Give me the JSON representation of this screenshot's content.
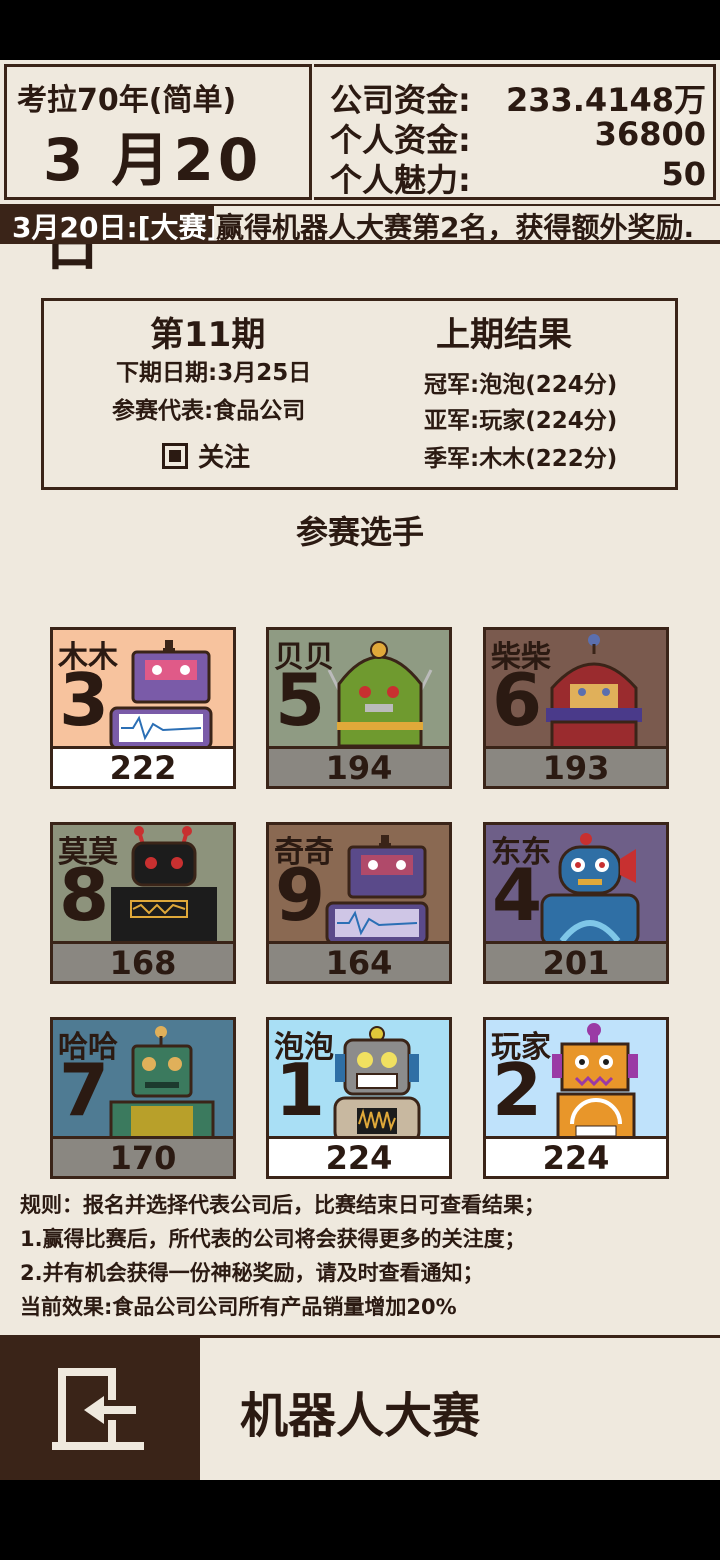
{
  "header": {
    "game_mode": "考拉70年(简单)",
    "date": "3 月20日",
    "company_funds_label": "公司资金:",
    "company_funds_value": "233.4148万",
    "personal_funds_label": "个人资金:",
    "personal_funds_value": "36800",
    "charm_label": "个人魅力:",
    "charm_value": "50"
  },
  "news": {
    "tag": "3月20日:[大赛]",
    "message": "赢得机器人大赛第2名，获得额外奖励."
  },
  "info": {
    "period": "第11期",
    "next_date": "下期日期:3月25日",
    "representative": "参赛代表:食品公司",
    "follow_label": "关注",
    "follow_checked": true,
    "last_results_title": "上期结果",
    "champion": "冠军:泡泡(224分)",
    "runner_up": "亚军:玩家(224分)",
    "third": "季军:木木(222分)"
  },
  "contestants_title": "参赛选手",
  "contestants": [
    {
      "name": "木木",
      "number": "3",
      "score": "222",
      "bg": "#f7c39e",
      "score_bg": "#ffffff"
    },
    {
      "name": "贝贝",
      "number": "5",
      "score": "194",
      "bg": "#8f9b83",
      "score_bg": "#8a8781"
    },
    {
      "name": "柴柴",
      "number": "6",
      "score": "193",
      "bg": "#7a5a4e",
      "score_bg": "#8a8781"
    },
    {
      "name": "莫莫",
      "number": "8",
      "score": "168",
      "bg": "#8d937c",
      "score_bg": "#8a8781"
    },
    {
      "name": "奇奇",
      "number": "9",
      "score": "164",
      "bg": "#8a6952",
      "score_bg": "#8a8781"
    },
    {
      "name": "东东",
      "number": "4",
      "score": "201",
      "bg": "#6e5f88",
      "score_bg": "#8a8781"
    },
    {
      "name": "哈哈",
      "number": "7",
      "score": "170",
      "bg": "#4f7b93",
      "score_bg": "#8a8781"
    },
    {
      "name": "泡泡",
      "number": "1",
      "score": "224",
      "bg": "#a9dff5",
      "score_bg": "#ffffff"
    },
    {
      "name": "玩家",
      "number": "2",
      "score": "224",
      "bg": "#bfe2fb",
      "score_bg": "#ffffff"
    }
  ],
  "rules": [
    "规则：报名并选择代表公司后，比赛结束日可查看结果；",
    "1.赢得比赛后，所代表的公司将会获得更多的关注度；",
    "2.并有机会获得一份神秘奖励，请及时查看通知；",
    "当前效果:食品公司公司所有产品销量增加20%"
  ],
  "footer": {
    "exit_icon": "exit-door-icon",
    "title": "机器人大赛"
  },
  "robot_art": [
    "robot-tv-purple",
    "robot-green-dome",
    "robot-red-dome",
    "robot-black-antenna",
    "robot-tv-purple",
    "robot-blue-round",
    "robot-green-square",
    "robot-silver-grin",
    "robot-orange-gauge"
  ],
  "colors": {
    "panel": "#efe9de",
    "border": "#3a2418",
    "news_bar": "#3a2418"
  }
}
